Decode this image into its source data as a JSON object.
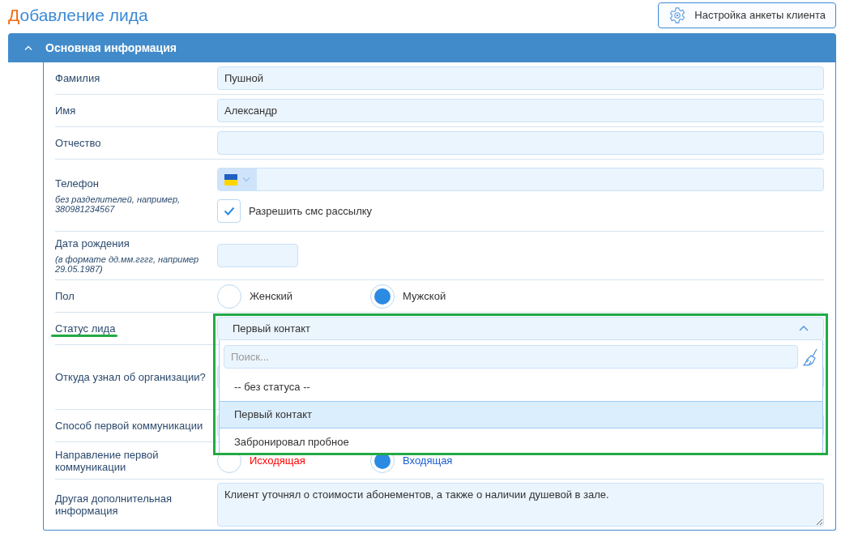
{
  "title": "Добавление лида",
  "settings_button": "Настройка анкеты клиента",
  "section": {
    "title": "Основная информация",
    "expanded": true
  },
  "fields": [
    {
      "kind": "text",
      "label": "Фамилия",
      "value": "Пушной"
    },
    {
      "kind": "text",
      "label": "Имя",
      "value": "Александр"
    },
    {
      "kind": "text",
      "label": "Отчество"
    },
    {
      "kind": "phone",
      "label": "Телефон",
      "hint": "без разделителей, например, 380981234567",
      "checkbox": {
        "label": "Разрешить смс рассылку",
        "checked": true
      }
    },
    {
      "kind": "date",
      "label": "Дата рождения",
      "hint": "(в формате дд.мм.гггг, например 29.05.1987)"
    },
    {
      "kind": "radio",
      "label": "Пол",
      "options": [
        {
          "label": "Женский",
          "selected": false
        },
        {
          "label": "Мужской",
          "selected": true
        }
      ]
    },
    {
      "kind": "select",
      "label": "Статус лида",
      "value": "Первый контакт",
      "expanded": true,
      "highlighted": true,
      "dropdown": {
        "placeholder": "Поиск...",
        "options": [
          {
            "label": "-- без статуса --",
            "selected": false
          },
          {
            "label": "Первый контакт",
            "selected": true
          },
          {
            "label": "Забронировал пробное",
            "selected": false
          }
        ]
      }
    },
    {
      "kind": "select",
      "label": "Откуда узнал об организации?"
    },
    {
      "kind": "select",
      "label": "Способ первой коммуникации"
    },
    {
      "kind": "radio",
      "label": "Направление первой коммуникации",
      "options": [
        {
          "label": "Исходящая",
          "selected": false,
          "color": "#ff0000"
        },
        {
          "label": "Входящая",
          "selected": true,
          "color": "#1a5fd0"
        }
      ]
    },
    {
      "kind": "textarea",
      "label": "Другая дополнительная информация",
      "value": "Клиент уточнял о стоимости абонементов, а также о наличии душевой в зале."
    }
  ]
}
